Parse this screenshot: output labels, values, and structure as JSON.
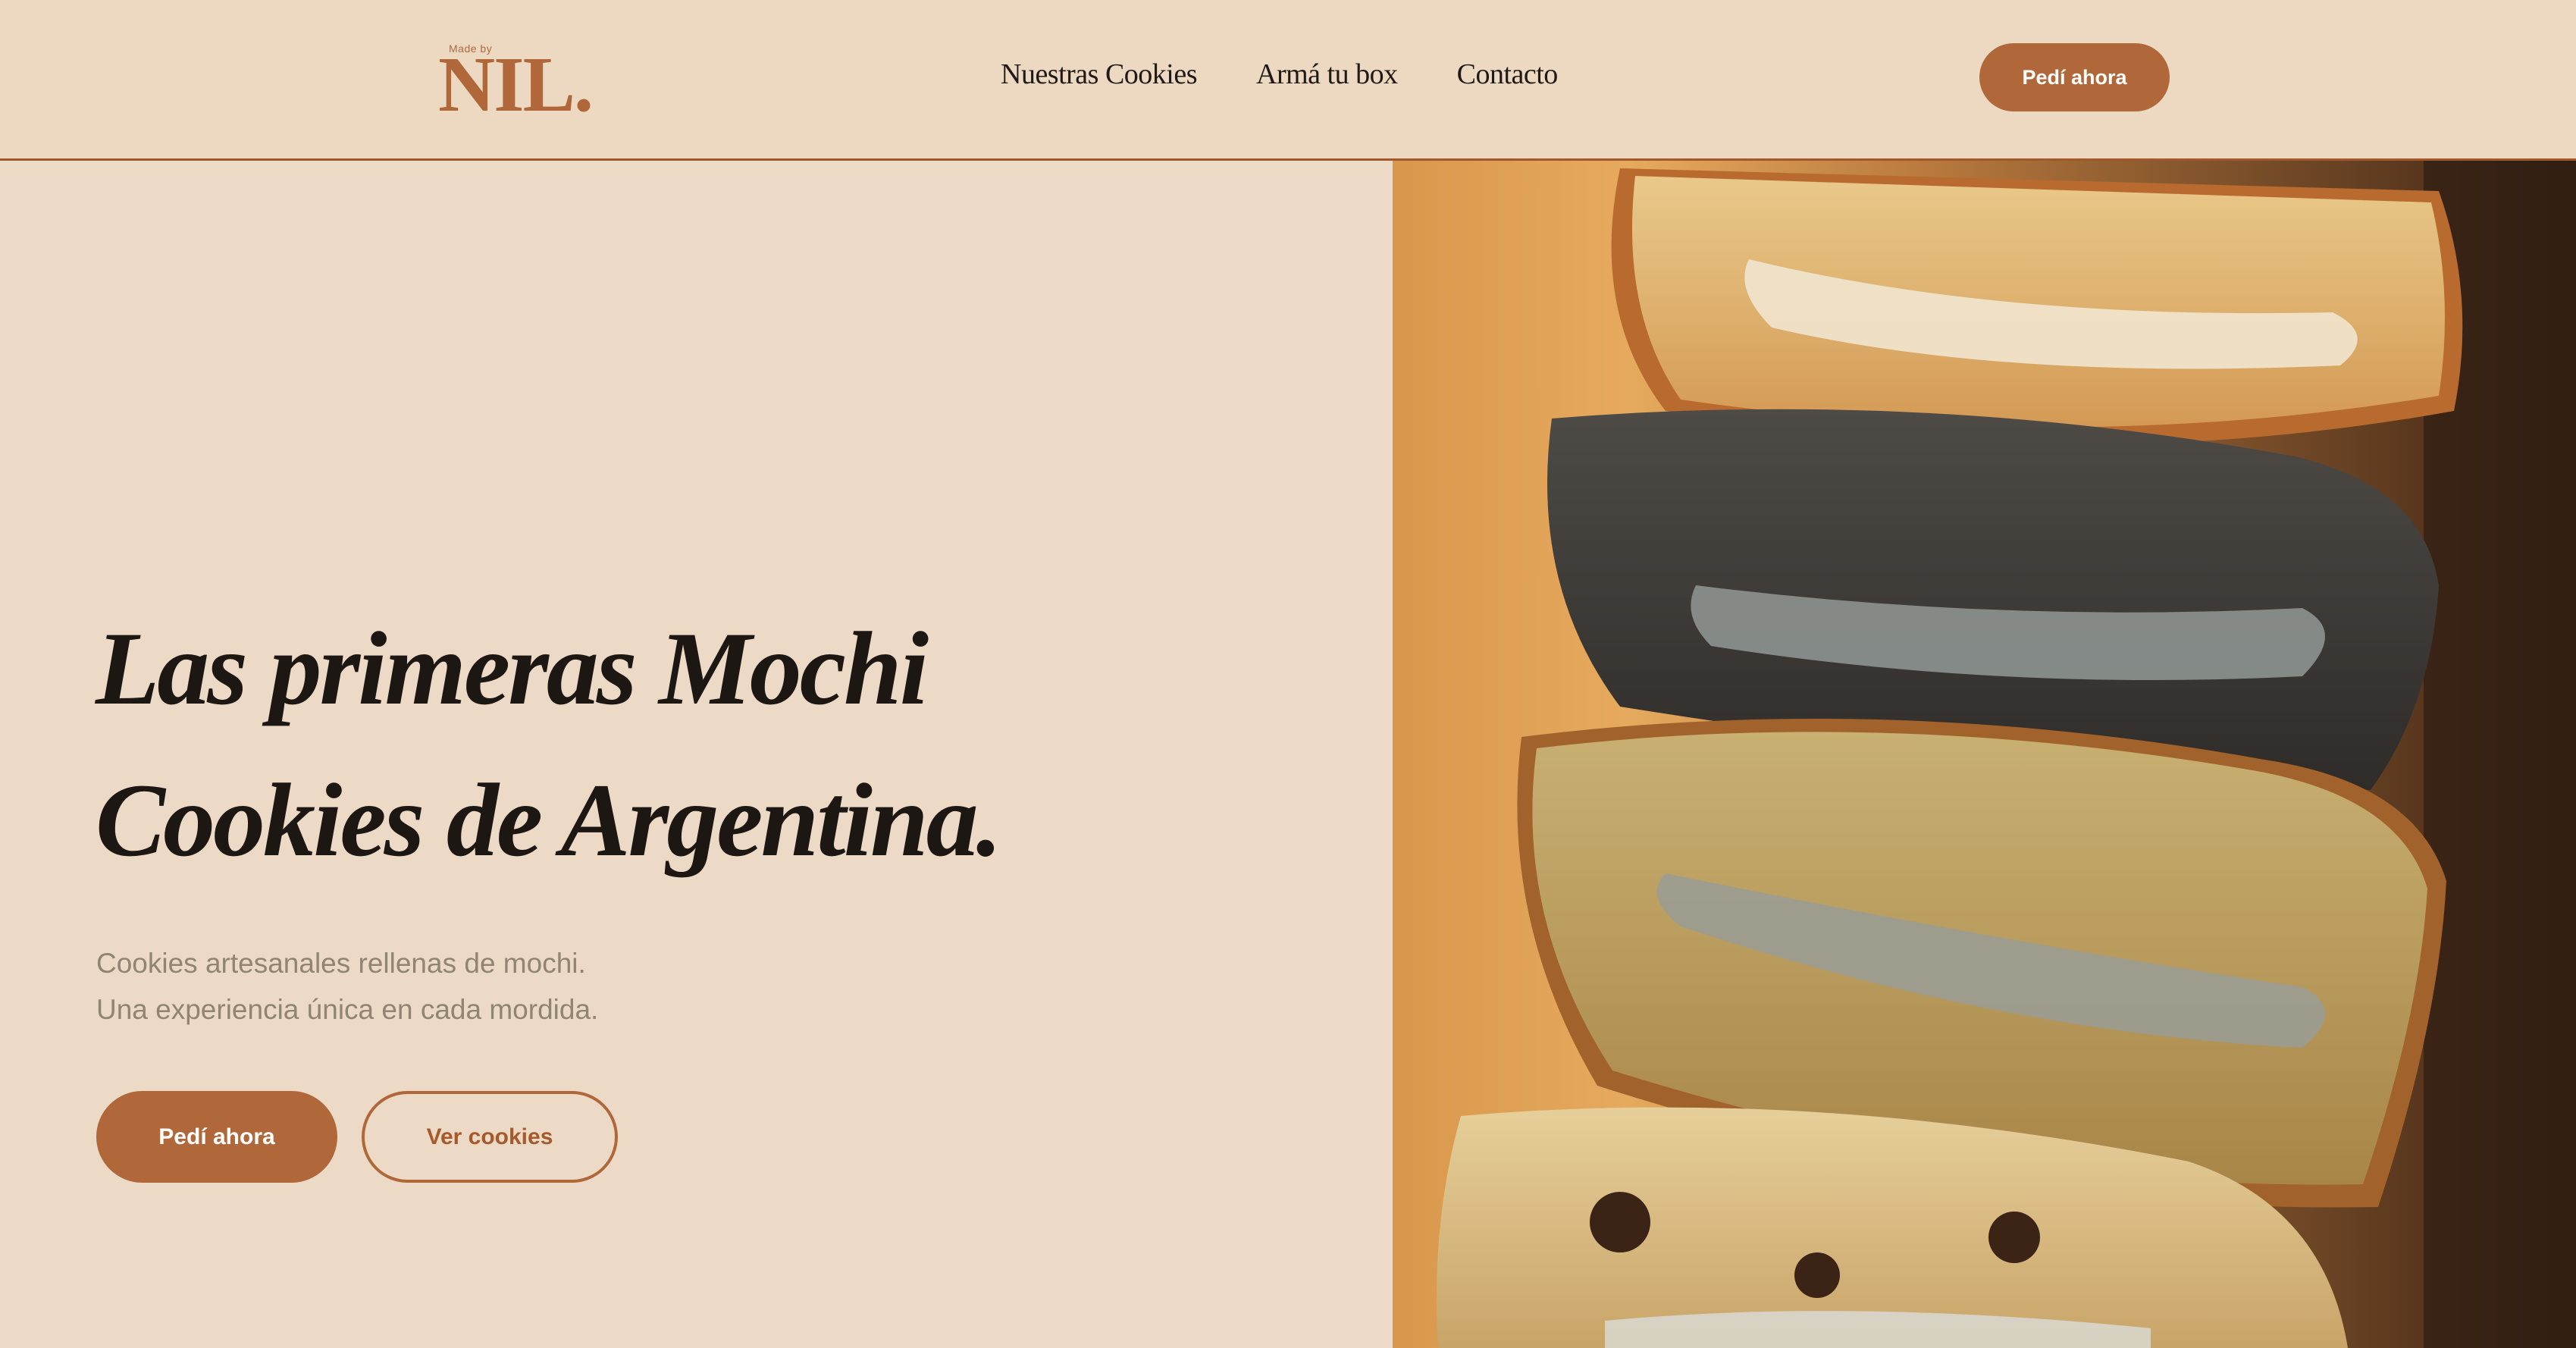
{
  "header": {
    "logo": {
      "small_text": "Made by",
      "main_text": "NIL."
    },
    "nav": [
      {
        "label": "Nuestras Cookies"
      },
      {
        "label": "Armá tu box"
      },
      {
        "label": "Contacto"
      }
    ],
    "cta_label": "Pedí ahora"
  },
  "hero": {
    "title_line1": "Las primeras Mochi",
    "title_line2": "Cookies de Argentina.",
    "subtitle_line1": "Cookies artesanales rellenas de mochi.",
    "subtitle_line2": "Una experiencia única en cada mordida.",
    "primary_button": "Pedí ahora",
    "secondary_button": "Ver cookies",
    "image_subject": "stack-of-mochi-cookies-photo"
  },
  "colors": {
    "background": "#eddac6",
    "accent": "#b0683a",
    "text_dark": "#1c1712",
    "text_muted": "#8f8573"
  }
}
